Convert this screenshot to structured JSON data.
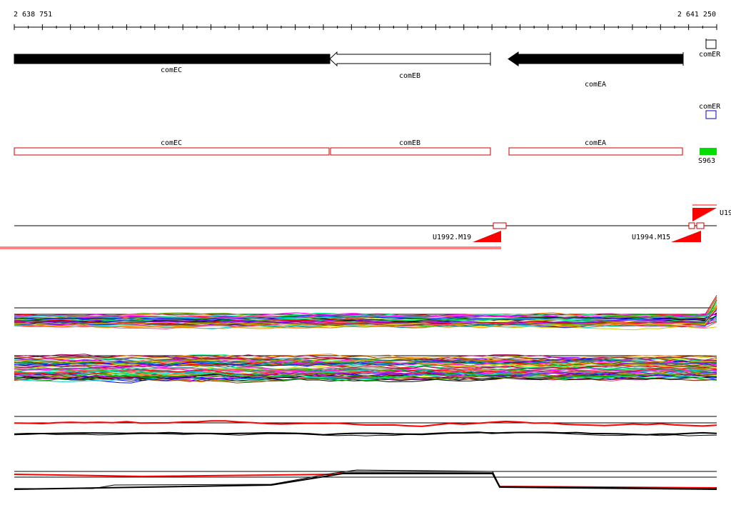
{
  "ruler": {
    "start_label": "2 638 751",
    "end_label": "2 641 250"
  },
  "genes_track": {
    "genes": [
      {
        "id": "comEC",
        "label": "comEC",
        "fill": "filled"
      },
      {
        "id": "comEB",
        "label": "comEB",
        "fill": "hollow"
      },
      {
        "id": "comEA",
        "label": "comEA",
        "fill": "filled"
      }
    ],
    "edge_label": "comER"
  },
  "second_track": {
    "edge_label": "comER"
  },
  "annotation_track": {
    "boxes": [
      {
        "id": "comEC",
        "label": "comEC"
      },
      {
        "id": "comEB",
        "label": "comEB"
      },
      {
        "id": "comEA",
        "label": "comEA"
      }
    ],
    "edge_label": "S963",
    "edge_color": "#00dd00"
  },
  "primer_track": {
    "primers": [
      {
        "id": "U1992",
        "label": "U1992.M19"
      },
      {
        "id": "U1994",
        "label": "U1994.M15"
      }
    ],
    "edge_label": "U19"
  },
  "colors": {
    "annotation_box": "#cc0000",
    "primer": "#ff0000",
    "gene_fill": "#000000"
  },
  "profile_palette": [
    "#ff0000",
    "#00aa00",
    "#0000ff",
    "#ff00ff",
    "#00cccc",
    "#cccc00",
    "#ff8800",
    "#8800ff",
    "#008888",
    "#884400",
    "#aa0055",
    "#55aa00",
    "#000000",
    "#777777",
    "#00ff88",
    "#ff4488"
  ]
}
